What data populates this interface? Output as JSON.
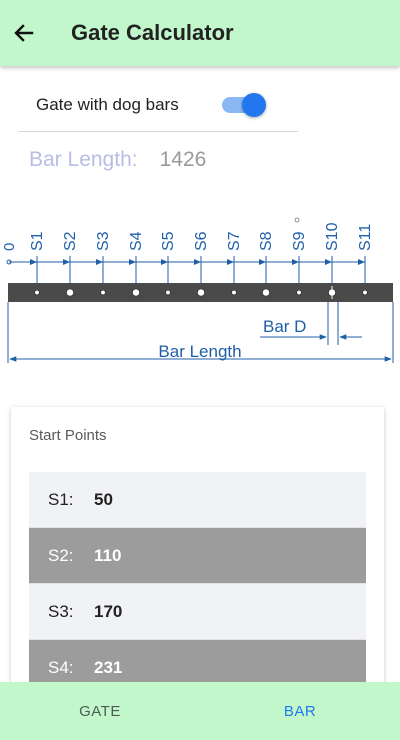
{
  "appbar": {
    "title": "Gate Calculator",
    "back_icon": "arrow-left-icon"
  },
  "options": {
    "dog_bars_label": "Gate with dog bars",
    "dog_bars_enabled": true
  },
  "bar_length": {
    "label": "Bar Length:",
    "value": "1426"
  },
  "diagram": {
    "origin_label": "0",
    "slot_labels": [
      "S1",
      "S2",
      "S3",
      "S4",
      "S5",
      "S6",
      "S7",
      "S8",
      "S9",
      "S10",
      "S11"
    ],
    "bar_d_label": "Bar D",
    "bar_length_label": "Bar Length",
    "colors": {
      "dimension": "#1f5fa8",
      "bar": "#4a4a4a"
    }
  },
  "start_points": {
    "title": "Start Points",
    "rows": [
      {
        "name": "S1:",
        "value": "50"
      },
      {
        "name": "S2:",
        "value": "110"
      },
      {
        "name": "S3:",
        "value": "170"
      },
      {
        "name": "S4:",
        "value": "231"
      }
    ]
  },
  "bottom_nav": {
    "gate_label": "GATE",
    "bar_label": "BAR",
    "active": "BAR"
  }
}
